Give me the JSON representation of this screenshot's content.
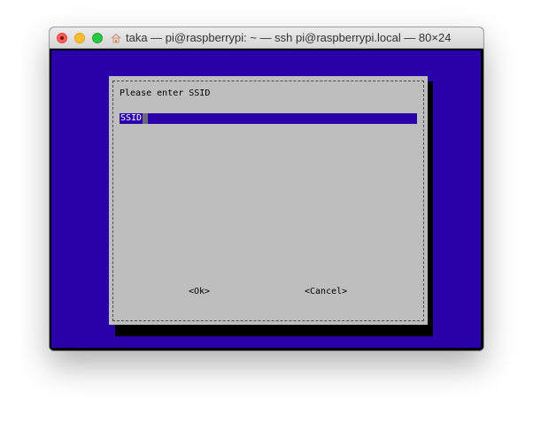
{
  "window": {
    "title": "taka — pi@raspberrypi: ~ — ssh pi@raspberrypi.local — 80×24",
    "title_icon": "home-icon"
  },
  "colors": {
    "terminal_background": "#2a00a8",
    "dialog_background": "#bebebe",
    "dialog_shadow": "#000000",
    "input_background": "#2a00a8"
  },
  "dialog": {
    "prompt": "Please enter SSID",
    "input": {
      "value": "SSID"
    },
    "buttons": {
      "ok": "<Ok>",
      "cancel": "<Cancel>"
    }
  }
}
